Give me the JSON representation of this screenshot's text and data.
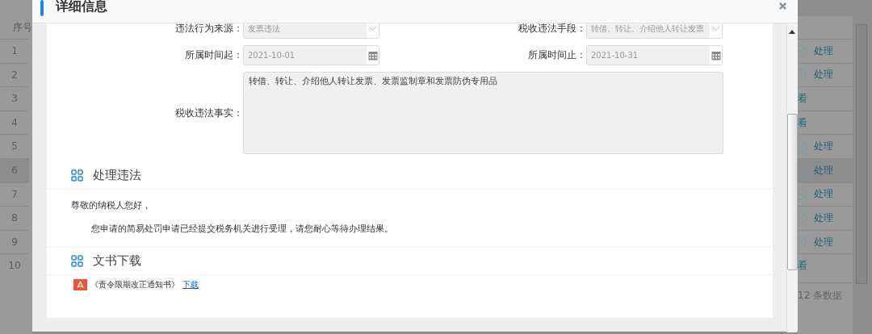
{
  "background_table": {
    "header": "序号",
    "rows": [
      {
        "number": "1",
        "action": "处理",
        "kind": "process"
      },
      {
        "number": "2",
        "action": "处理",
        "kind": "process"
      },
      {
        "number": "3",
        "action": "看",
        "kind": "view"
      },
      {
        "number": "4",
        "action": "看",
        "kind": "view"
      },
      {
        "number": "5",
        "action": "处理",
        "kind": "process"
      },
      {
        "number": "6",
        "action": "处理",
        "kind": "process"
      },
      {
        "number": "7",
        "action": "处理",
        "kind": "process"
      },
      {
        "number": "8",
        "action": "处理",
        "kind": "process"
      },
      {
        "number": "9",
        "action": "处理",
        "kind": "process"
      },
      {
        "number": "10",
        "action": "看",
        "kind": "view"
      }
    ],
    "footer": "12 条数据"
  },
  "dialog": {
    "title": "详细信息",
    "fields": [
      {
        "label": "违法行为来源：",
        "value": "发票违法",
        "kind": "select",
        "disabled": true
      },
      {
        "label": "税收违法手段：",
        "value": "转借、转让、介绍他人转让发票",
        "kind": "select",
        "disabled": true
      },
      {
        "label": "所属时间起：",
        "value": "2021-10-01",
        "kind": "date",
        "disabled": true
      },
      {
        "label": "所属时间止：",
        "value": "2021-10-31",
        "kind": "date",
        "disabled": true
      }
    ],
    "facts": {
      "label": "税收违法事实：",
      "value": "转借、转让、介绍他人转让发票、发票监制章和发票防伪专用品"
    },
    "handling": {
      "title": "处理违法",
      "greeting": "尊敬的纳税人您好，",
      "message": "您申请的简易处罚申请已经提交税务机关进行受理，请您耐心等待办理结果。"
    },
    "documents": {
      "title": "文书下载",
      "items": [
        {
          "name": "《责令限期改正通知书》",
          "link": "下载"
        }
      ]
    }
  }
}
